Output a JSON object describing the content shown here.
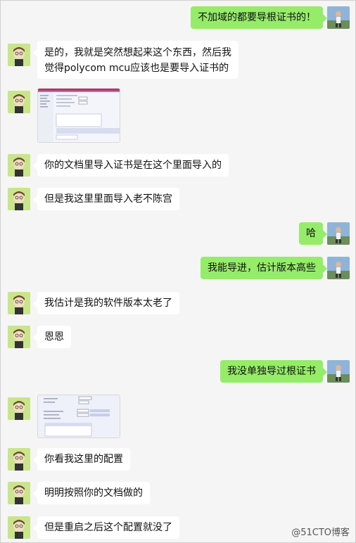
{
  "messages": [
    {
      "side": "right",
      "text": "不加域的都要导根证书的！"
    },
    {
      "side": "left",
      "lines": [
        "是的，我就是突然想起来这个东西，然后我",
        "觉得polycom mcu应该也是要导入证书的"
      ]
    },
    {
      "side": "left",
      "type": "image"
    },
    {
      "side": "left",
      "text": "你的文档里导入证书是在这个里面导入的"
    },
    {
      "side": "left",
      "text": "但是我这里里面导入老不陈宫"
    },
    {
      "side": "right",
      "text": "哈"
    },
    {
      "side": "right",
      "text": "我能导进，估计版本高些"
    },
    {
      "side": "left",
      "text": "我估计是我的软件版本太老了"
    },
    {
      "side": "left",
      "text": "恩恩"
    },
    {
      "side": "right",
      "text": "我没单独导过根证书"
    },
    {
      "side": "left",
      "type": "image"
    },
    {
      "side": "left",
      "text": "你看我这里的配置"
    },
    {
      "side": "left",
      "text": "明明按照你的文档做的"
    },
    {
      "side": "left",
      "text": "但是重启之后这个配置就没了"
    }
  ],
  "watermark": "@51CTO博客",
  "colors": {
    "background": "#f5f5f5",
    "bubble_left": "#ffffff",
    "bubble_right": "#95ec69"
  }
}
